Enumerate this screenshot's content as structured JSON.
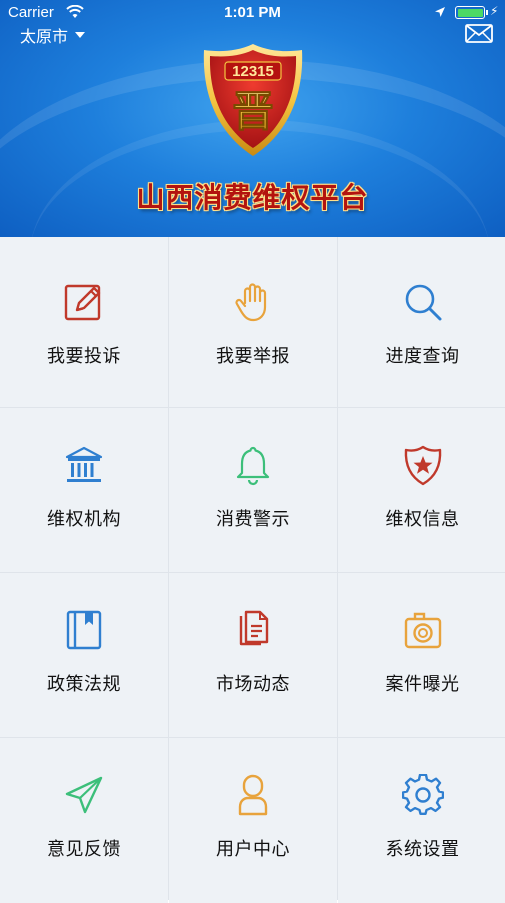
{
  "status_bar": {
    "carrier": "Carrier",
    "time": "1:01 PM"
  },
  "header": {
    "city": "太原市",
    "emblem_number": "12315",
    "emblem_char": "晋",
    "platform_title": "山西消费维权平台",
    "colors": {
      "background": "#1e7fdc",
      "title": "#b3140f",
      "emblem_gold": "#f4c542",
      "emblem_red": "#c8161d"
    }
  },
  "menu": {
    "items": [
      {
        "label": "我要投诉",
        "icon": "complaint-pen-icon",
        "color": "#c0392b"
      },
      {
        "label": "我要举报",
        "icon": "raised-hand-icon",
        "color": "#e8a33c"
      },
      {
        "label": "进度查询",
        "icon": "magnifier-search-icon",
        "color": "#2f7fd0"
      },
      {
        "label": "维权机构",
        "icon": "institution-building-icon",
        "color": "#2f7fd0"
      },
      {
        "label": "消费警示",
        "icon": "bell-icon",
        "color": "#3cbf7a"
      },
      {
        "label": "维权信息",
        "icon": "star-shield-icon",
        "color": "#c0392b"
      },
      {
        "label": "政策法规",
        "icon": "bookmark-book-icon",
        "color": "#2f7fd0"
      },
      {
        "label": "市场动态",
        "icon": "documents-icon",
        "color": "#c0392b"
      },
      {
        "label": "案件曝光",
        "icon": "camera-icon",
        "color": "#e8a33c"
      },
      {
        "label": "意见反馈",
        "icon": "paper-plane-icon",
        "color": "#3cbf7a"
      },
      {
        "label": "用户中心",
        "icon": "user-icon",
        "color": "#e8a33c"
      },
      {
        "label": "系统设置",
        "icon": "gear-settings-icon",
        "color": "#2f7fd0"
      }
    ]
  }
}
